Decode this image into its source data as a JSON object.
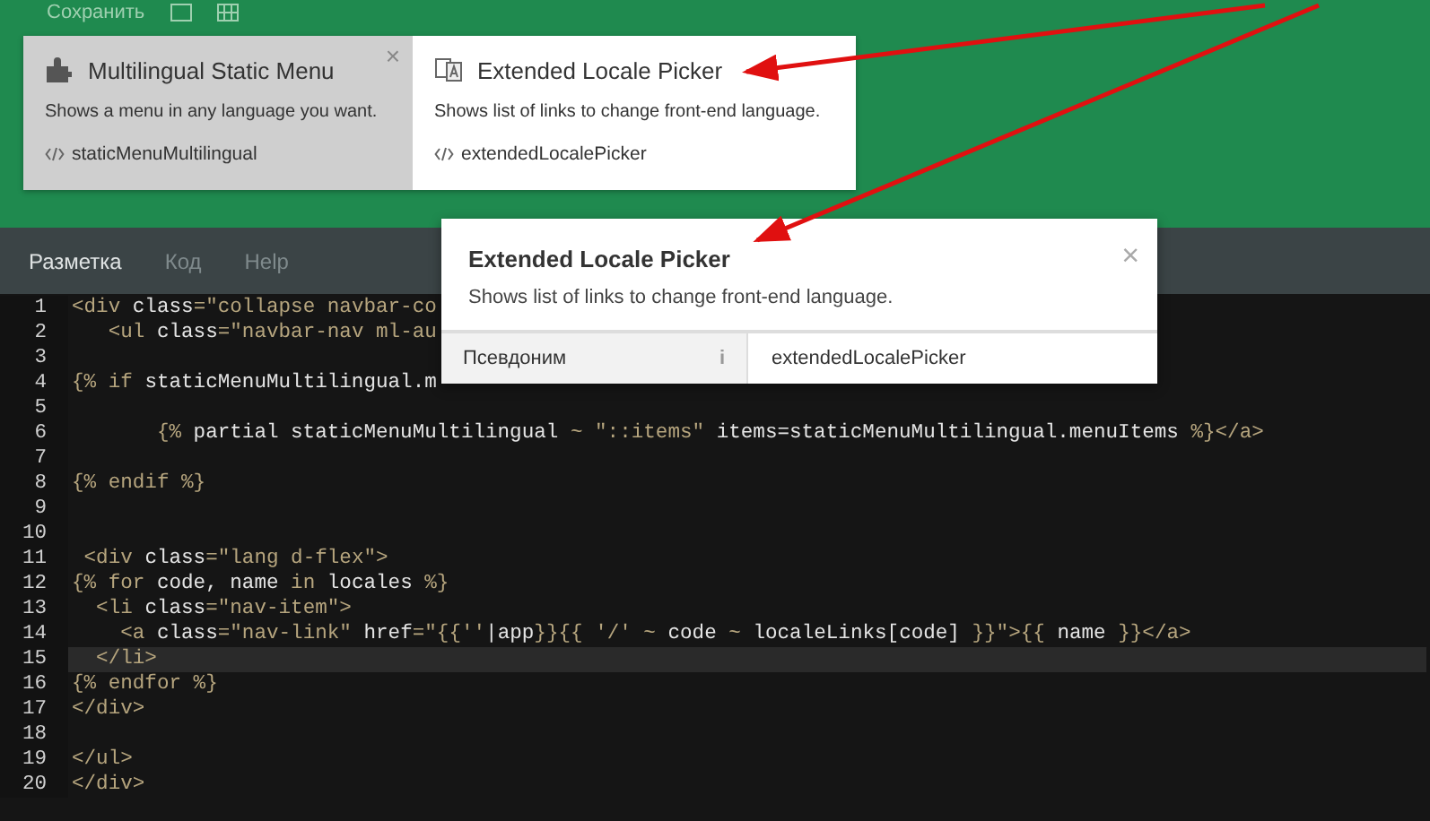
{
  "toolbar": {
    "save_label": "Сохранить"
  },
  "components": [
    {
      "title": "Multilingual Static Menu",
      "description": "Shows a menu in any language you want.",
      "alias": "staticMenuMultilingual",
      "selected": false,
      "close": "×"
    },
    {
      "title": "Extended Locale Picker",
      "description": "Shows list of links to change front-end language.",
      "alias": "extendedLocalePicker",
      "selected": true
    }
  ],
  "editor_tabs": [
    {
      "label": "Разметка",
      "selected": true
    },
    {
      "label": "Код",
      "selected": false
    },
    {
      "label": "Help",
      "selected": false
    }
  ],
  "code_lines": [
    {
      "number": "1",
      "current": false,
      "segments": [
        {
          "kind": "markup",
          "text": "<div "
        },
        {
          "kind": "plain",
          "text": "class"
        },
        {
          "kind": "markup",
          "text": "=\"collapse navbar-co"
        }
      ]
    },
    {
      "number": "2",
      "current": false,
      "segments": [
        {
          "kind": "markup",
          "text": "   <ul "
        },
        {
          "kind": "plain",
          "text": "class"
        },
        {
          "kind": "markup",
          "text": "=\"navbar-nav ml-au"
        }
      ]
    },
    {
      "number": "3",
      "current": false
    },
    {
      "number": "4",
      "current": false,
      "segments": [
        {
          "kind": "markup",
          "text": "{% if "
        },
        {
          "kind": "plain",
          "text": "staticMenuMultilingual.m"
        }
      ]
    },
    {
      "number": "5",
      "current": false
    },
    {
      "number": "6",
      "current": false,
      "segments": [
        {
          "kind": "markup",
          "text": "       {% "
        },
        {
          "kind": "plain",
          "text": "partial staticMenuMultilingual "
        },
        {
          "kind": "markup",
          "text": "~ \"::items\" "
        },
        {
          "kind": "plain",
          "text": "items=staticMenuMultilingual.menuItems "
        },
        {
          "kind": "markup",
          "text": "%}</a>"
        }
      ]
    },
    {
      "number": "7",
      "current": false
    },
    {
      "number": "8",
      "current": false,
      "segments": [
        {
          "kind": "markup",
          "text": "{% endif %}"
        }
      ]
    },
    {
      "number": "9",
      "current": false
    },
    {
      "number": "10",
      "current": false
    },
    {
      "number": "11",
      "current": false,
      "segments": [
        {
          "kind": "markup",
          "text": " <div "
        },
        {
          "kind": "plain",
          "text": "class"
        },
        {
          "kind": "markup",
          "text": "=\"lang d-flex\">"
        }
      ]
    },
    {
      "number": "12",
      "current": false,
      "segments": [
        {
          "kind": "markup",
          "text": "{% for "
        },
        {
          "kind": "plain",
          "text": "code, name "
        },
        {
          "kind": "markup",
          "text": "in "
        },
        {
          "kind": "plain",
          "text": "locales "
        },
        {
          "kind": "markup",
          "text": "%}"
        }
      ]
    },
    {
      "number": "13",
      "current": false,
      "segments": [
        {
          "kind": "markup",
          "text": "  <li "
        },
        {
          "kind": "plain",
          "text": "class"
        },
        {
          "kind": "markup",
          "text": "=\"nav-item\">"
        }
      ]
    },
    {
      "number": "14",
      "current": false,
      "segments": [
        {
          "kind": "markup",
          "text": "    <a "
        },
        {
          "kind": "plain",
          "text": "class"
        },
        {
          "kind": "markup",
          "text": "=\"nav-link\" "
        },
        {
          "kind": "plain",
          "text": "href"
        },
        {
          "kind": "markup",
          "text": "=\"{{''"
        },
        {
          "kind": "plain",
          "text": "|app"
        },
        {
          "kind": "markup",
          "text": "}}{{ '/' ~ "
        },
        {
          "kind": "plain",
          "text": "code "
        },
        {
          "kind": "markup",
          "text": "~ "
        },
        {
          "kind": "plain",
          "text": "localeLinks[code] "
        },
        {
          "kind": "markup",
          "text": "}}\">{{ "
        },
        {
          "kind": "plain",
          "text": "name "
        },
        {
          "kind": "markup",
          "text": "}}</a>"
        }
      ]
    },
    {
      "number": "15",
      "current": true,
      "segments": [
        {
          "kind": "markup",
          "text": "  </li>"
        }
      ]
    },
    {
      "number": "16",
      "current": false,
      "segments": [
        {
          "kind": "markup",
          "text": "{% endfor %}"
        }
      ]
    },
    {
      "number": "17",
      "current": false,
      "segments": [
        {
          "kind": "markup",
          "text": "</div>"
        }
      ]
    },
    {
      "number": "18",
      "current": false
    },
    {
      "number": "19",
      "current": false,
      "segments": [
        {
          "kind": "markup",
          "text": "</ul>"
        }
      ]
    },
    {
      "number": "20",
      "current": false,
      "segments": [
        {
          "kind": "markup",
          "text": "</div>"
        }
      ]
    }
  ],
  "popup": {
    "title": "Extended Locale Picker",
    "description": "Shows list of links to change front-end language.",
    "close": "×",
    "property_label": "Псевдоним",
    "property_info": "i",
    "property_value": "extendedLocalePicker"
  }
}
